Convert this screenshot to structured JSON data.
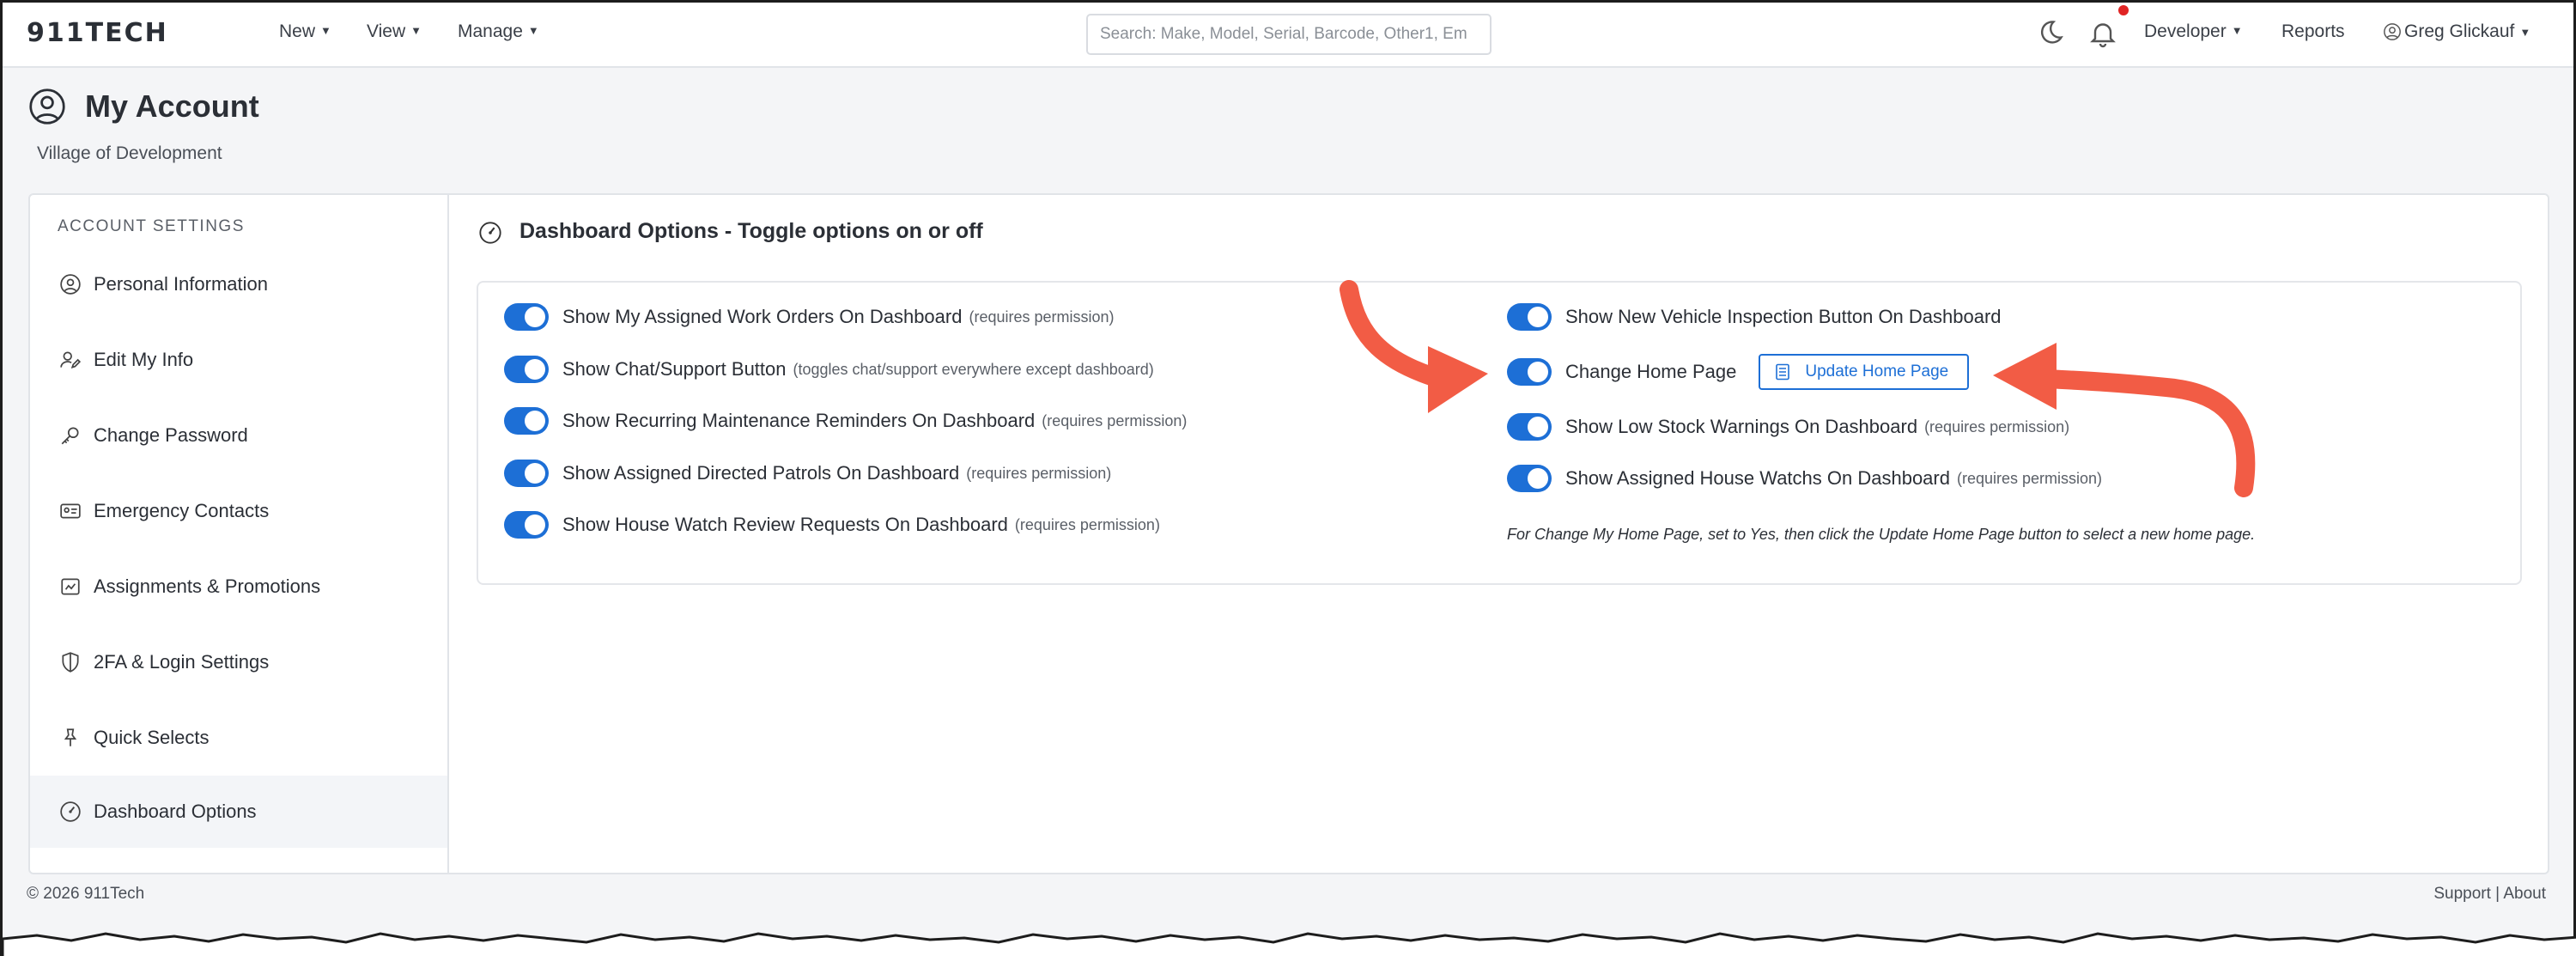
{
  "header": {
    "logo": "911TECH",
    "nav": [
      {
        "label": "New"
      },
      {
        "label": "View"
      },
      {
        "label": "Manage"
      }
    ],
    "search_placeholder": "Search: Make, Model, Serial, Barcode, Other1, Em",
    "right": {
      "developer": "Developer",
      "reports": "Reports",
      "user": "Greg Glickauf"
    }
  },
  "page": {
    "title": "My Account",
    "subtitle": "Village of Development"
  },
  "sidebar": {
    "heading": "ACCOUNT SETTINGS",
    "items": [
      {
        "label": "Personal Information",
        "icon": "user-circle-icon"
      },
      {
        "label": "Edit My Info",
        "icon": "user-edit-icon"
      },
      {
        "label": "Change Password",
        "icon": "key-icon"
      },
      {
        "label": "Emergency Contacts",
        "icon": "id-card-icon"
      },
      {
        "label": "Assignments & Promotions",
        "icon": "assignment-icon"
      },
      {
        "label": "2FA & Login Settings",
        "icon": "shield-icon"
      },
      {
        "label": "Quick Selects",
        "icon": "pin-icon"
      },
      {
        "label": "Dashboard Options",
        "icon": "dashboard-icon",
        "active": true
      }
    ]
  },
  "content": {
    "title": "Dashboard Options - Toggle options on or off",
    "left_options": [
      {
        "label": "Show My Assigned Work Orders On Dashboard",
        "note": "(requires permission)",
        "on": true
      },
      {
        "label": "Show Chat/Support Button",
        "note": "(toggles chat/support everywhere except dashboard)",
        "on": true
      },
      {
        "label": "Show Recurring Maintenance Reminders On Dashboard",
        "note": "(requires permission)",
        "on": true
      },
      {
        "label": "Show Assigned Directed Patrols On Dashboard",
        "note": "(requires permission)",
        "on": true
      },
      {
        "label": "Show House Watch Review Requests On Dashboard",
        "note": "(requires permission)",
        "on": true
      }
    ],
    "right_options": [
      {
        "label": "Show New Vehicle Inspection Button On Dashboard",
        "note": "",
        "on": true
      },
      {
        "label": "Change Home Page",
        "note": "",
        "on": true
      },
      {
        "label": "Show Low Stock Warnings On Dashboard",
        "note": "(requires permission)",
        "on": true
      },
      {
        "label": "Show Assigned House Watchs On Dashboard",
        "note": "(requires permission)",
        "on": true
      }
    ],
    "update_button": "Update Home Page",
    "help_text": "For Change My Home Page, set to Yes, then click the Update Home Page button to select a new home page."
  },
  "footer": {
    "copyright": "© 2026 911Tech",
    "support": "Support",
    "separator": "|",
    "about": "About"
  },
  "colors": {
    "accent": "#1d6fd6",
    "annotation_arrow": "#f25c45",
    "notification_dot": "#e02424"
  }
}
